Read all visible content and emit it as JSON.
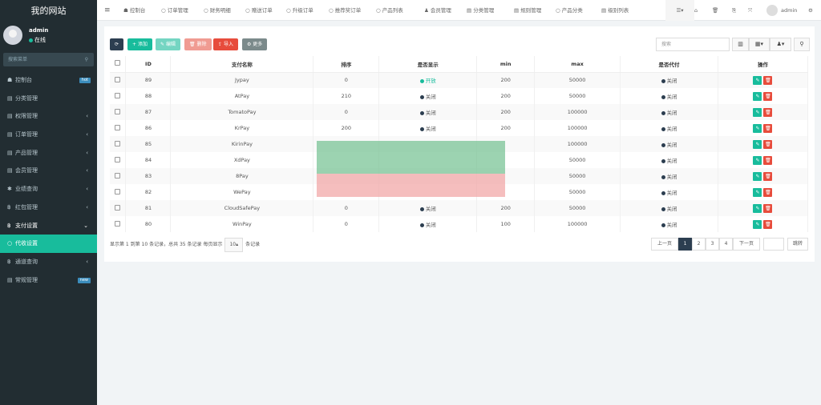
{
  "site_title": "我的网站",
  "user": {
    "name": "admin",
    "status": "在线",
    "status_color": "#18bc9c"
  },
  "sidebar_search_placeholder": "搜索菜单",
  "sidebar": [
    {
      "label": "控制台",
      "icon": "dashboard-icon",
      "badge": "hot"
    },
    {
      "label": "分类管理",
      "icon": "list-icon"
    },
    {
      "label": "权限管理",
      "icon": "list-icon",
      "arrow": "‹"
    },
    {
      "label": "订单管理",
      "icon": "list-icon",
      "arrow": "‹"
    },
    {
      "label": "产品管理",
      "icon": "list-icon",
      "arrow": "‹"
    },
    {
      "label": "会员管理",
      "icon": "list-icon",
      "arrow": "‹"
    },
    {
      "label": "业绩查询",
      "icon": "asterisk-icon",
      "arrow": "‹"
    },
    {
      "label": "红包管理",
      "icon": "bitcoin-icon",
      "arrow": "‹"
    },
    {
      "label": "支付设置",
      "icon": "bitcoin-icon",
      "arrow": "⌄",
      "state": "open"
    },
    {
      "label": "代收设置",
      "icon": "circle-icon",
      "state": "active"
    },
    {
      "label": "通道查询",
      "icon": "bitcoin-icon",
      "arrow": "‹"
    },
    {
      "label": "常规管理",
      "icon": "list-icon",
      "badge": "new"
    }
  ],
  "topnav": [
    {
      "label": "控制台",
      "icon": "dashboard-icon",
      "glyph": "☗"
    },
    {
      "label": "订单管理",
      "icon": "circle-icon",
      "glyph": "○"
    },
    {
      "label": "财务明细",
      "icon": "circle-icon",
      "glyph": "○"
    },
    {
      "label": "赠送订单",
      "icon": "circle-icon",
      "glyph": "○"
    },
    {
      "label": "升级订单",
      "icon": "circle-icon",
      "glyph": "○"
    },
    {
      "label": "推荐奖订单",
      "icon": "circle-icon",
      "glyph": "○"
    },
    {
      "label": "产品列表",
      "icon": "circle-icon",
      "glyph": "○"
    },
    {
      "label": "会员管理",
      "icon": "user-icon",
      "glyph": "♟"
    },
    {
      "label": "分类管理",
      "icon": "list-icon",
      "glyph": "▤"
    },
    {
      "label": "规则管理",
      "icon": "list-icon",
      "glyph": "▤"
    },
    {
      "label": "产品分类",
      "icon": "circle-icon",
      "glyph": "○"
    },
    {
      "label": "级别列表",
      "icon": "list-icon",
      "glyph": "▤"
    }
  ],
  "top_admin": "admin",
  "toolbar": {
    "add": "添加",
    "edit": "编辑",
    "delete": "删除",
    "import": "导入",
    "more": "更多",
    "search_placeholder": "搜索"
  },
  "colors": {
    "primary": "#18bc9c",
    "danger": "#e74c3c",
    "dark": "#2c3e50"
  },
  "table": {
    "headers": [
      "ID",
      "支付名称",
      "排序",
      "是否显示",
      "min",
      "max",
      "是否代付",
      "操作"
    ],
    "rows": [
      {
        "id": "89",
        "name": "Jypay",
        "sort": "0",
        "show": "开放",
        "show_on": true,
        "min": "200",
        "max": "50000",
        "payout": "关闭"
      },
      {
        "id": "88",
        "name": "AtPay",
        "sort": "210",
        "show": "关闭",
        "min": "200",
        "max": "50000",
        "payout": "关闭"
      },
      {
        "id": "87",
        "name": "TomatoPay",
        "sort": "0",
        "show": "关闭",
        "min": "200",
        "max": "100000",
        "payout": "关闭"
      },
      {
        "id": "86",
        "name": "KrPay",
        "sort": "200",
        "show": "关闭",
        "min": "200",
        "max": "100000",
        "payout": "关闭"
      },
      {
        "id": "85",
        "name": "KirinPay",
        "max": "100000",
        "payout": "关闭"
      },
      {
        "id": "84",
        "name": "XdPay",
        "max": "50000",
        "payout": "关闭"
      },
      {
        "id": "83",
        "name": "8Pay",
        "max": "50000",
        "payout": "关闭"
      },
      {
        "id": "82",
        "name": "WePay",
        "max": "50000",
        "payout": "关闭"
      },
      {
        "id": "81",
        "name": "CloudSafePay",
        "sort": "0",
        "show": "关闭",
        "min": "200",
        "max": "50000",
        "payout": "关闭"
      },
      {
        "id": "80",
        "name": "WinPay",
        "sort": "0",
        "show": "关闭",
        "min": "100",
        "max": "100000",
        "payout": "关闭"
      }
    ]
  },
  "footer": {
    "summary": "显示第 1 到第 10 条记录，总共 35 条记录 每页显示",
    "page_size": "10▴",
    "suffix": "条记录"
  },
  "pagination": {
    "prev": "上一页",
    "pages": [
      "1",
      "2",
      "3",
      "4"
    ],
    "current": "1",
    "next": "下一页",
    "go": "跳转"
  }
}
